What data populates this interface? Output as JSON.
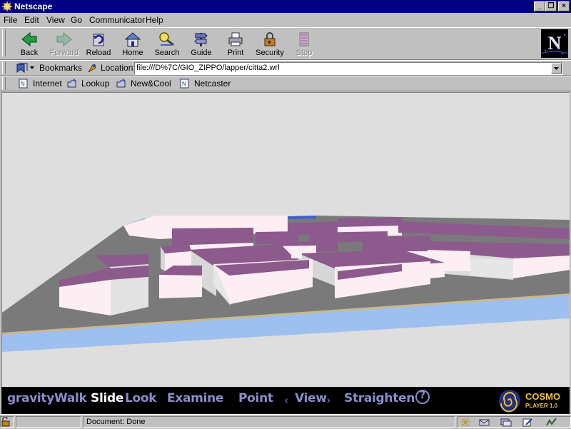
{
  "window": {
    "title": "Netscape",
    "minimize": "_",
    "maximize": "❐",
    "close": "×"
  },
  "menu": [
    "File",
    "Edit",
    "View",
    "Go",
    "Communicator",
    "Help"
  ],
  "toolbar": {
    "back": "Back",
    "forward": "Forward",
    "reload": "Reload",
    "home": "Home",
    "search": "Search",
    "guide": "Guide",
    "print": "Print",
    "security": "Security",
    "stop": "Stop"
  },
  "location": {
    "bookmarks": "Bookmarks",
    "label": "Location:",
    "url": "file:///D%7C/GIO_ZIPPO/lapper/citta2.wrl"
  },
  "personal": [
    "Internet",
    "Lookup",
    "New&Cool",
    "Netcaster"
  ],
  "cosmo": {
    "items": [
      "gravity",
      "Walk",
      "Slide",
      "Look",
      "Examine",
      "Point",
      "View",
      "Straighten",
      "?"
    ],
    "active": "Slide",
    "logo_line1": "COSMO",
    "logo_line2": "PLAYER 1.0"
  },
  "status": {
    "text": "Document: Done"
  },
  "colors": {
    "titlebar": "#000080",
    "chrome": "#c0c0c0",
    "roof": "#8c5a8c",
    "wall": "#ffeef4",
    "ground": "#7a7a7a",
    "water": "#9ec0f0",
    "cosmo_text": "#8c8ccc"
  }
}
